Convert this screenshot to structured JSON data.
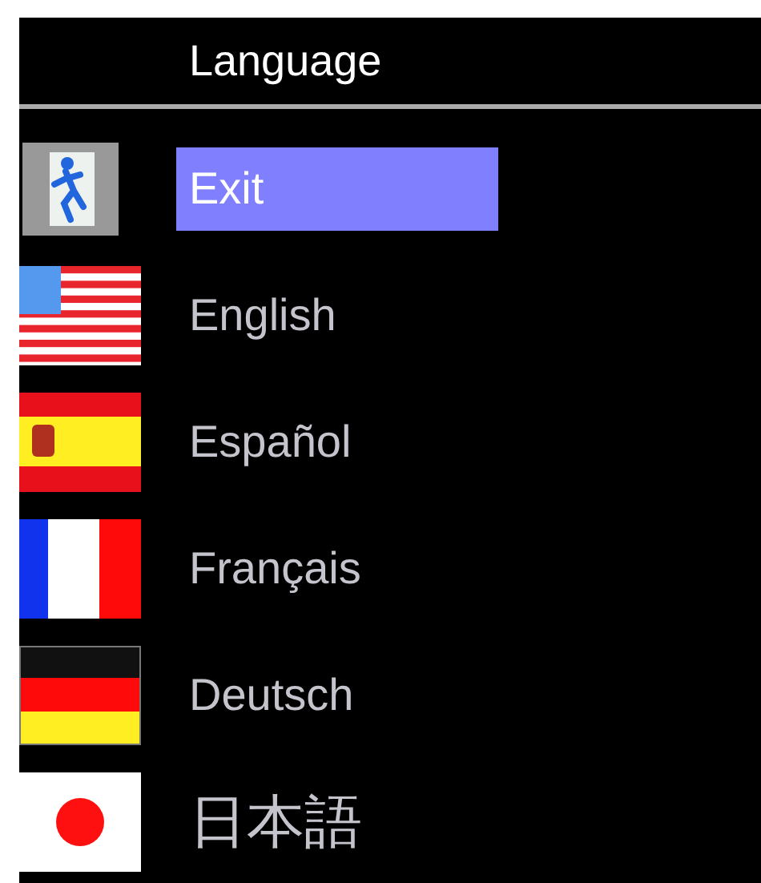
{
  "menu": {
    "title": "Language"
  },
  "items": [
    {
      "kind": "exit",
      "label": "Exit",
      "selected": true
    },
    {
      "kind": "us",
      "label": "English",
      "selected": false
    },
    {
      "kind": "es",
      "label": "Español",
      "selected": false
    },
    {
      "kind": "fr",
      "label": "Français",
      "selected": false
    },
    {
      "kind": "de",
      "label": "Deutsch",
      "selected": false
    },
    {
      "kind": "jp",
      "label": "日本語",
      "selected": false
    }
  ]
}
